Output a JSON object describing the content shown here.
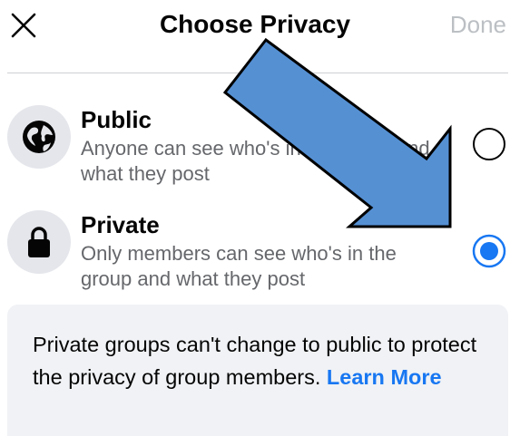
{
  "header": {
    "title": "Choose Privacy",
    "done_label": "Done",
    "close_icon": "close-icon"
  },
  "options": [
    {
      "title": "Public",
      "description": "Anyone can see who's in the group and what they post",
      "icon": "globe-icon",
      "selected": false
    },
    {
      "title": "Private",
      "description": "Only members can see who's in the group and what they post",
      "icon": "lock-icon",
      "selected": true
    }
  ],
  "info": {
    "text": "Private groups can't change to public to protect the privacy of group members. ",
    "link_label": "Learn More"
  },
  "annotation": {
    "arrow_color": "#5590d3",
    "arrow_outline": "#000000"
  },
  "colors": {
    "accent": "#1877f2",
    "secondary_text": "#65676b",
    "disabled_text": "#bcc0c4",
    "icon_bg": "#e4e6eb",
    "info_bg": "#f0f2f5"
  }
}
